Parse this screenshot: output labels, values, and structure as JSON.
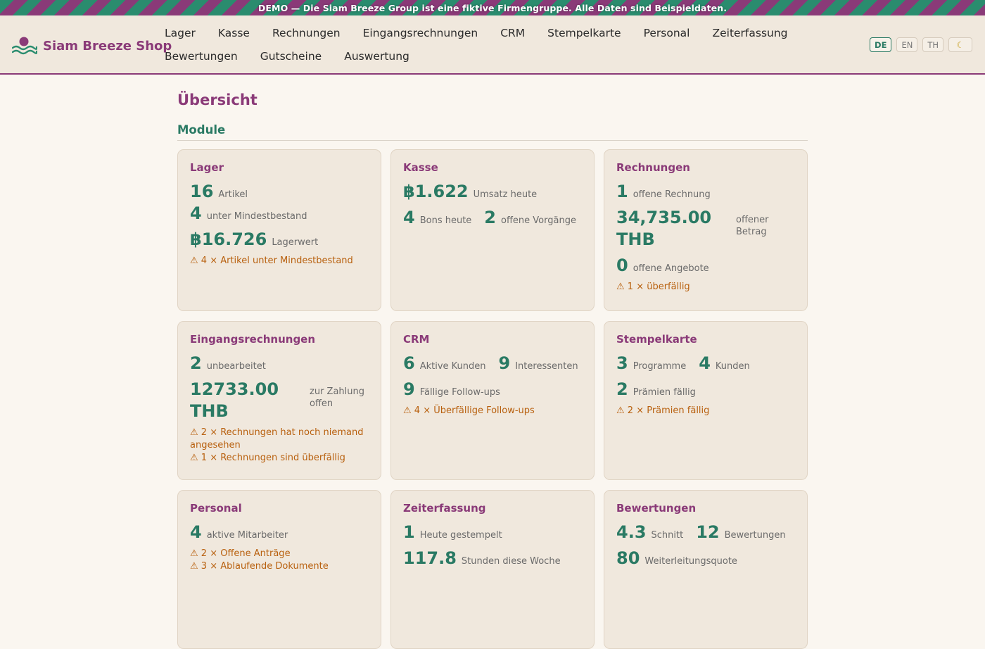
{
  "banner": "DEMO — Die Siam Breeze Group ist eine fiktive Firmengruppe. Alle Daten sind Beispieldaten.",
  "brand": {
    "name": "Siam Breeze Shop",
    "icon": "wave-sun-logo-icon"
  },
  "nav": [
    "Lager",
    "Kasse",
    "Rechnungen",
    "Eingangsrechnungen",
    "CRM",
    "Stempelkarte",
    "Personal",
    "Zeiterfassung",
    "Bewertungen",
    "Gutscheine",
    "Auswertung"
  ],
  "lang": {
    "de": "DE",
    "en": "EN",
    "th": "TH",
    "active": "DE",
    "theme_icon": "moon-icon"
  },
  "page": {
    "title": "Übersicht",
    "section": "Module"
  },
  "colors": {
    "accent_purple": "#8a3a78",
    "accent_green": "#2a7a64",
    "warning": "#b8600e"
  },
  "cards": {
    "lager": {
      "title": "Lager",
      "artikel_val": "16",
      "artikel_lbl": "Artikel",
      "min_val": "4",
      "min_lbl": "unter Mindestbestand",
      "wert_val": "฿16.726",
      "wert_lbl": "Lagerwert",
      "warn1": "⚠ 4 × Artikel unter Mindestbestand"
    },
    "kasse": {
      "title": "Kasse",
      "umsatz_val": "฿1.622",
      "umsatz_lbl": "Umsatz heute",
      "bons_val": "4",
      "bons_lbl": "Bons heute",
      "vorg_val": "2",
      "vorg_lbl": "offene Vorgänge"
    },
    "rechnungen": {
      "title": "Rechnungen",
      "offen_val": "1",
      "offen_lbl": "offene Rechnung",
      "betrag_val": "34,735.00 THB",
      "betrag_lbl": "offener Betrag",
      "angebote_val": "0",
      "angebote_lbl": "offene Angebote",
      "warn1": "⚠ 1 × überfällig"
    },
    "eingang": {
      "title": "Eingangsrechnungen",
      "unbe_val": "2",
      "unbe_lbl": "unbearbeitet",
      "zahl_val": "12733.00 THB",
      "zahl_lbl": "zur Zahlung offen",
      "warn1": "⚠ 2 × Rechnungen hat noch niemand angesehen",
      "warn2": "⚠ 1 × Rechnungen sind überfällig"
    },
    "crm": {
      "title": "CRM",
      "kunden_val": "6",
      "kunden_lbl": "Aktive Kunden",
      "int_val": "9",
      "int_lbl": "Interessenten",
      "fu_val": "9",
      "fu_lbl": "Fällige Follow-ups",
      "warn1": "⚠ 4 × Überfällige Follow-ups"
    },
    "stempel": {
      "title": "Stempelkarte",
      "prog_val": "3",
      "prog_lbl": "Programme",
      "kunden_val": "4",
      "kunden_lbl": "Kunden",
      "praem_val": "2",
      "praem_lbl": "Prämien fällig",
      "warn1": "⚠ 2 × Prämien fällig"
    },
    "personal": {
      "title": "Personal",
      "ma_val": "4",
      "ma_lbl": "aktive Mitarbeiter",
      "warn1": "⚠ 2 × Offene Anträge",
      "warn2": "⚠ 3 × Ablaufende Dokumente"
    },
    "zeit": {
      "title": "Zeiterfassung",
      "heute_val": "1",
      "heute_lbl": "Heute gestempelt",
      "std_val": "117.8",
      "std_lbl": "Stunden diese Woche"
    },
    "bewert": {
      "title": "Bewertungen",
      "schnitt_val": "4.3",
      "schnitt_lbl": "Schnitt",
      "anz_val": "12",
      "anz_lbl": "Bewertungen",
      "quote_val": "80",
      "quote_lbl": "Weiterleitungsquote"
    }
  }
}
